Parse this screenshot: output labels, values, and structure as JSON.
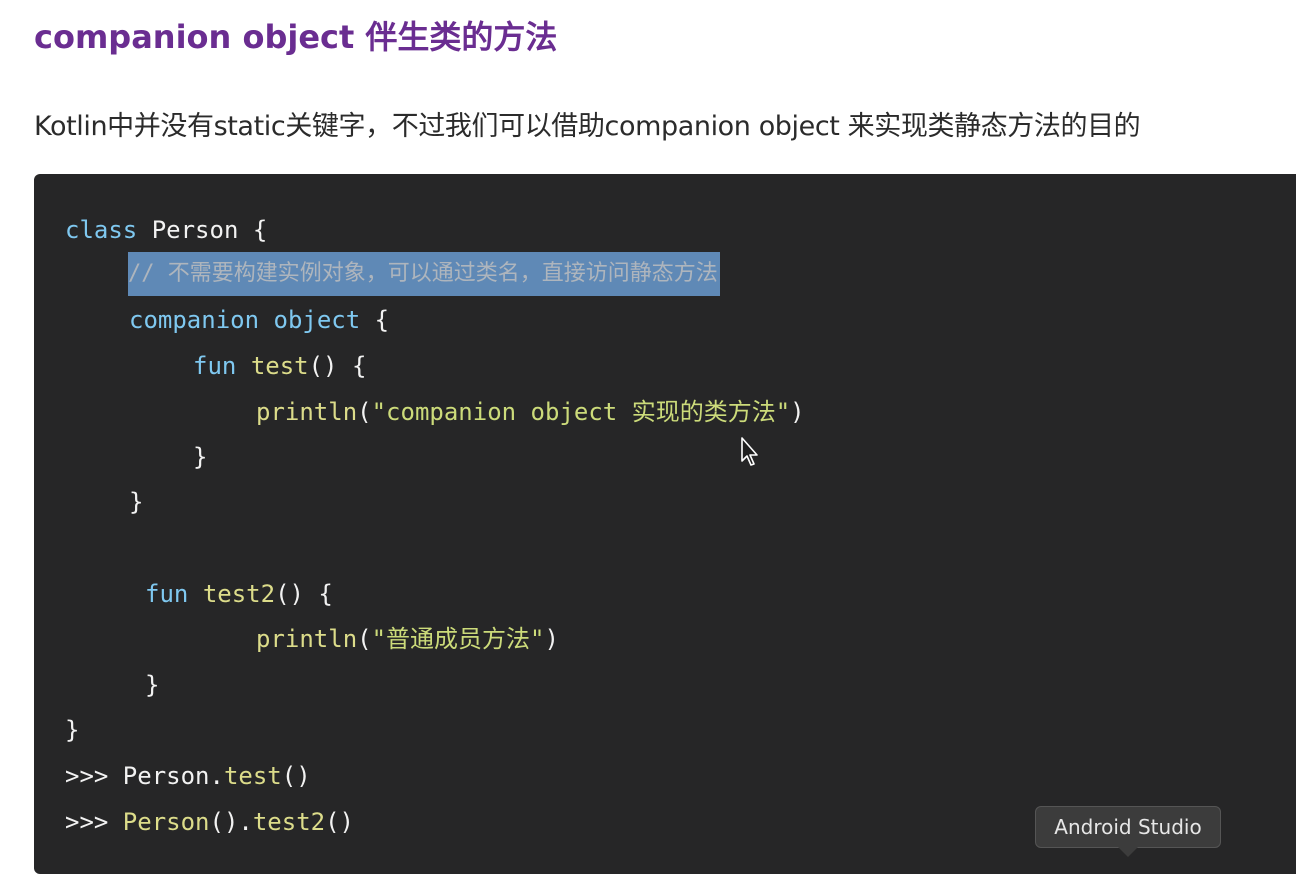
{
  "heading": "companion object 伴生类的方法",
  "intro": "Kotlin中并没有static关键字，不过我们可以借助companion object 来实现类静态方法的目的",
  "code": {
    "l1": {
      "kw": "class",
      "rest": " Person {"
    },
    "l2": {
      "comment": "// 不需要构建实例对象，可以通过类名，直接访问静态方法"
    },
    "l3": {
      "kw1": "companion",
      "sp": " ",
      "kw2": "object",
      "rest": " {"
    },
    "l4": {
      "kw": "fun",
      "sp": " ",
      "fn": "test",
      "rest": "() {"
    },
    "l5": {
      "fn": "println",
      "open": "(",
      "str": "\"companion object 实现的类方法\"",
      "close": ")"
    },
    "l6": {
      "text": "}"
    },
    "l7": {
      "text": "}"
    },
    "l8": {
      "kw": "fun",
      "sp": " ",
      "fn": "test2",
      "rest": "() {"
    },
    "l9": {
      "fn": "println",
      "open": "(",
      "str": "\"普通成员方法\"",
      "close": ")"
    },
    "l10": {
      "text": "}"
    },
    "l11": {
      "text": "}"
    },
    "l12": {
      "prompt": ">>> ",
      "cls": "Person",
      "dot": ".",
      "fn": "test",
      "rest": "()"
    },
    "l13": {
      "prompt": ">>> ",
      "cls": "Person",
      "mid": "().",
      "fn": "test2",
      "rest": "()"
    }
  },
  "tooltip": "Android Studio",
  "icons": {
    "cursor": "mouse-pointer-icon"
  }
}
